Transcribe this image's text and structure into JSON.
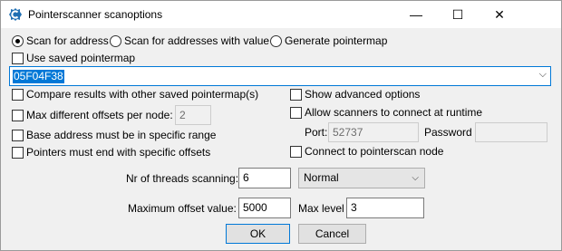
{
  "window": {
    "title": "Pointerscanner scanoptions"
  },
  "titlebar_buttons": {
    "minimize": "—",
    "maximize": "☐",
    "close": "✕"
  },
  "scan_mode": {
    "options": [
      "Scan for address",
      "Scan for addresses with value",
      "Generate pointermap"
    ],
    "selected": "Scan for address"
  },
  "use_saved_pointermap": {
    "label": "Use saved pointermap",
    "checked": false
  },
  "address": {
    "value": "05F04F38",
    "arrow": "⌵"
  },
  "left_options": {
    "compare": {
      "label": "Compare results with other saved pointermap(s)",
      "checked": false
    },
    "max_diff": {
      "label": "Max different offsets per node:",
      "value": "2",
      "checked": false
    },
    "base_range": {
      "label": "Base address must be in specific range",
      "checked": false
    },
    "end_offsets": {
      "label": "Pointers must end with specific offsets",
      "checked": false
    }
  },
  "right_options": {
    "show_advanced": {
      "label": "Show advanced options",
      "checked": false
    },
    "allow_scanners": {
      "label": "Allow scanners to connect at runtime",
      "checked": false
    },
    "port_label": "Port:",
    "port_value": "52737",
    "password_label": "Password",
    "password_value": "",
    "connect_node": {
      "label": "Connect to pointerscan node",
      "checked": false
    }
  },
  "threads": {
    "label": "Nr of threads scanning:",
    "value": "6",
    "priority": "Normal",
    "priority_arrow": "⌵"
  },
  "max_offset": {
    "label": "Maximum offset value:",
    "value": "5000"
  },
  "max_level": {
    "label": "Max level",
    "value": "3"
  },
  "buttons": {
    "ok": "OK",
    "cancel": "Cancel"
  }
}
